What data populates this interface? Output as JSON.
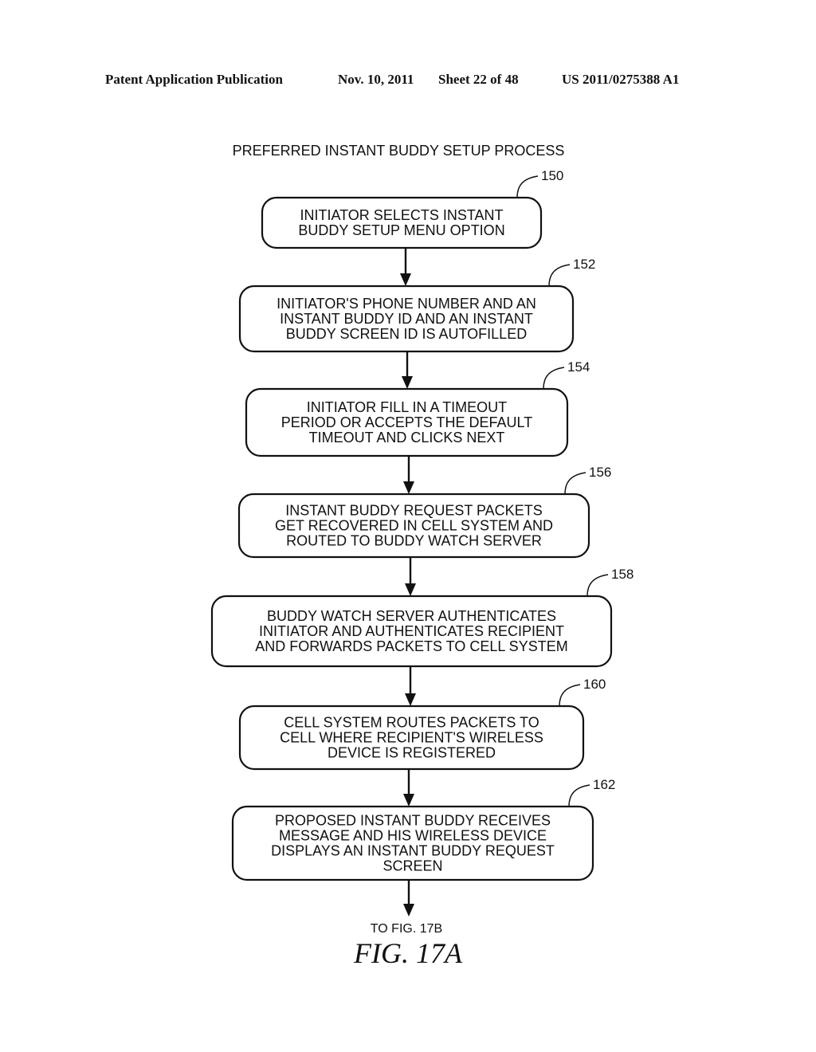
{
  "header": {
    "publication": "Patent Application Publication",
    "date": "Nov. 10, 2011",
    "sheet": "Sheet 22 of 48",
    "number": "US 2011/0275388 A1"
  },
  "diagram": {
    "title": "PREFERRED INSTANT BUDDY SETUP PROCESS",
    "steps": [
      {
        "ref": "150",
        "lines": [
          "INITIATOR SELECTS INSTANT",
          "BUDDY SETUP MENU OPTION"
        ]
      },
      {
        "ref": "152",
        "lines": [
          "INITIATOR'S PHONE NUMBER AND AN",
          "INSTANT BUDDY ID AND AN INSTANT",
          "BUDDY SCREEN ID IS AUTOFILLED"
        ]
      },
      {
        "ref": "154",
        "lines": [
          "INITIATOR FILL IN A TIMEOUT",
          "PERIOD OR ACCEPTS THE DEFAULT",
          "TIMEOUT AND CLICKS NEXT"
        ]
      },
      {
        "ref": "156",
        "lines": [
          "INSTANT BUDDY REQUEST PACKETS",
          "GET RECOVERED IN CELL SYSTEM AND",
          "ROUTED TO BUDDY WATCH SERVER"
        ]
      },
      {
        "ref": "158",
        "lines": [
          "BUDDY WATCH SERVER AUTHENTICATES",
          "INITIATOR AND AUTHENTICATES RECIPIENT",
          "AND FORWARDS PACKETS TO CELL SYSTEM"
        ]
      },
      {
        "ref": "160",
        "lines": [
          "CELL SYSTEM ROUTES PACKETS TO",
          "CELL WHERE RECIPIENT'S WIRELESS",
          "DEVICE IS REGISTERED"
        ]
      },
      {
        "ref": "162",
        "lines": [
          "PROPOSED INSTANT BUDDY RECEIVES",
          "MESSAGE AND HIS WIRELESS DEVICE",
          "DISPLAYS AN INSTANT BUDDY REQUEST",
          "SCREEN"
        ]
      }
    ],
    "continuation": "TO FIG. 17B",
    "figure_label": "FIG. 17A"
  }
}
